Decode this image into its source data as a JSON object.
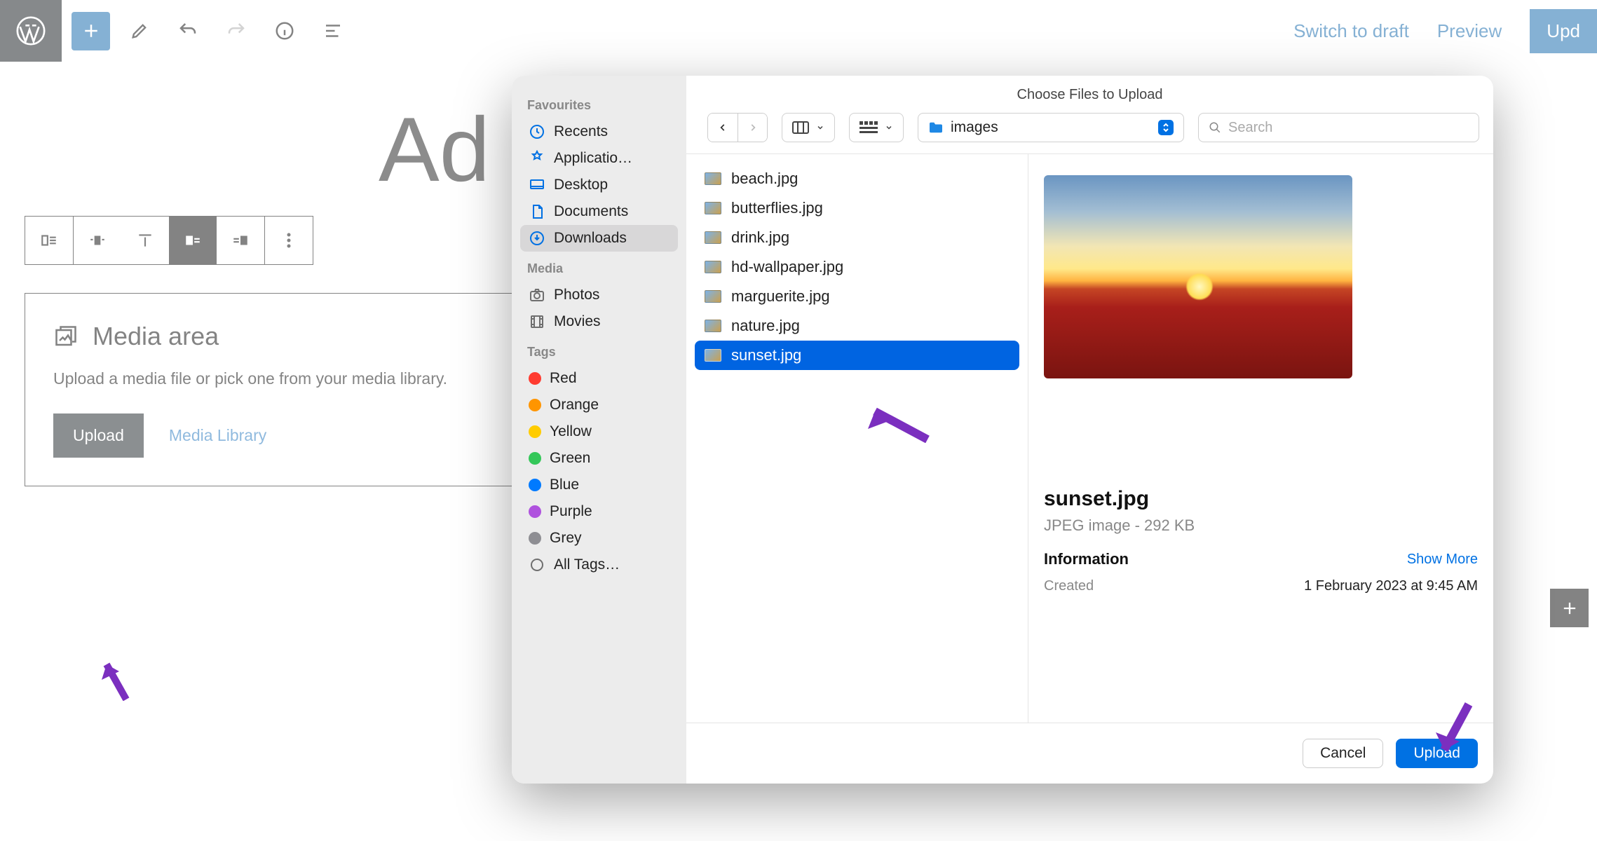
{
  "wp": {
    "topbar": {
      "switch_draft": "Switch to draft",
      "preview": "Preview",
      "update": "Upd"
    },
    "title": "Ad",
    "media_block": {
      "heading": "Media area",
      "description": "Upload a media file or pick one from your media library.",
      "upload_label": "Upload",
      "library_label": "Media Library"
    }
  },
  "dialog": {
    "title": "Choose Files to Upload",
    "folder_label": "images",
    "search_placeholder": "Search",
    "sidebar": {
      "favourites_label": "Favourites",
      "favourites": [
        {
          "label": "Recents",
          "icon": "clock"
        },
        {
          "label": "Applicatio…",
          "icon": "apps"
        },
        {
          "label": "Desktop",
          "icon": "desktop"
        },
        {
          "label": "Documents",
          "icon": "doc"
        },
        {
          "label": "Downloads",
          "icon": "download",
          "selected": true
        }
      ],
      "media_label": "Media",
      "media": [
        {
          "label": "Photos",
          "icon": "camera"
        },
        {
          "label": "Movies",
          "icon": "film"
        }
      ],
      "tags_label": "Tags",
      "tags": [
        {
          "label": "Red",
          "color": "#ff3b30"
        },
        {
          "label": "Orange",
          "color": "#ff9500"
        },
        {
          "label": "Yellow",
          "color": "#ffcc00"
        },
        {
          "label": "Green",
          "color": "#34c759"
        },
        {
          "label": "Blue",
          "color": "#007aff"
        },
        {
          "label": "Purple",
          "color": "#af52de"
        },
        {
          "label": "Grey",
          "color": "#8e8e93"
        },
        {
          "label": "All Tags…",
          "color": null
        }
      ]
    },
    "files": [
      {
        "name": "beach.jpg"
      },
      {
        "name": "butterflies.jpg"
      },
      {
        "name": "drink.jpg"
      },
      {
        "name": "hd-wallpaper.jpg"
      },
      {
        "name": "marguerite.jpg"
      },
      {
        "name": "nature.jpg"
      },
      {
        "name": "sunset.jpg",
        "selected": true
      }
    ],
    "preview": {
      "name": "sunset.jpg",
      "meta": "JPEG image - 292 KB",
      "info_label": "Information",
      "show_more": "Show More",
      "created_label": "Created",
      "created_value": "1 February 2023 at 9:45 AM"
    },
    "footer": {
      "cancel": "Cancel",
      "upload": "Upload"
    }
  }
}
